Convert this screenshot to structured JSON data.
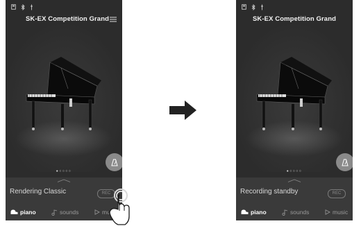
{
  "screens": [
    {
      "title": "SK-EX Competition Grand",
      "status_text": "Rendering Classic",
      "rec_label": "REC",
      "tabs": [
        {
          "label": "piano",
          "icon": "piano-icon",
          "active": true
        },
        {
          "label": "sounds",
          "icon": "music-note-icon",
          "active": false
        },
        {
          "label": "music",
          "icon": "play-icon",
          "active": false
        }
      ],
      "page_indicator": "●○○○○",
      "has_menu": true
    },
    {
      "title": "SK-EX Competition Grand",
      "status_text": "Recording standby",
      "rec_label": "REC",
      "tabs": [
        {
          "label": "piano",
          "icon": "piano-icon",
          "active": true
        },
        {
          "label": "sounds",
          "icon": "music-note-icon",
          "active": false
        },
        {
          "label": "music",
          "icon": "play-icon",
          "active": false
        }
      ],
      "page_indicator": "●○○○○",
      "has_menu": false
    }
  ],
  "colors": {
    "screen_bg": "#2c2c2c",
    "panel_bg": "#3a3a3a",
    "metronome_button": "#8a8a8a",
    "arrow": "#222222"
  }
}
